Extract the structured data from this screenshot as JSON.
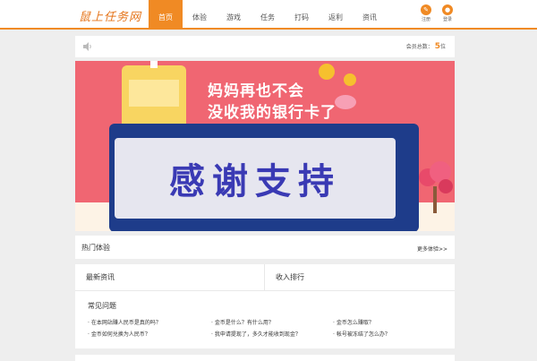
{
  "header": {
    "logo": "鼠上任务网",
    "nav": [
      "首页",
      "体验",
      "游戏",
      "任务",
      "打码",
      "返利",
      "资讯"
    ],
    "register_label": "注册",
    "login_label": "登录",
    "accent": "#f08a24"
  },
  "notice": {
    "icon": "speaker-icon",
    "members_label": "会员总数：",
    "members_count": "5",
    "members_unit": "位"
  },
  "banner": {
    "slogan_line1": "妈妈再也不会",
    "slogan_line2": "没收我的银行卡了",
    "overlay_text": "感谢支持"
  },
  "hot": {
    "title": "热门体验",
    "more": "更多体验>>"
  },
  "tabs": [
    "最新资讯",
    "收入排行"
  ],
  "faq": {
    "title": "常见问题",
    "items": [
      "· 在本网站赚人民币是真的吗？",
      "· 金币是什么？有什么用？",
      "· 金币怎么赚取？",
      "· 金币如何兑换为人民币？",
      "· 我申请提现了，多久才能收到现金？",
      "· 帐号被冻结了怎么办？"
    ]
  }
}
